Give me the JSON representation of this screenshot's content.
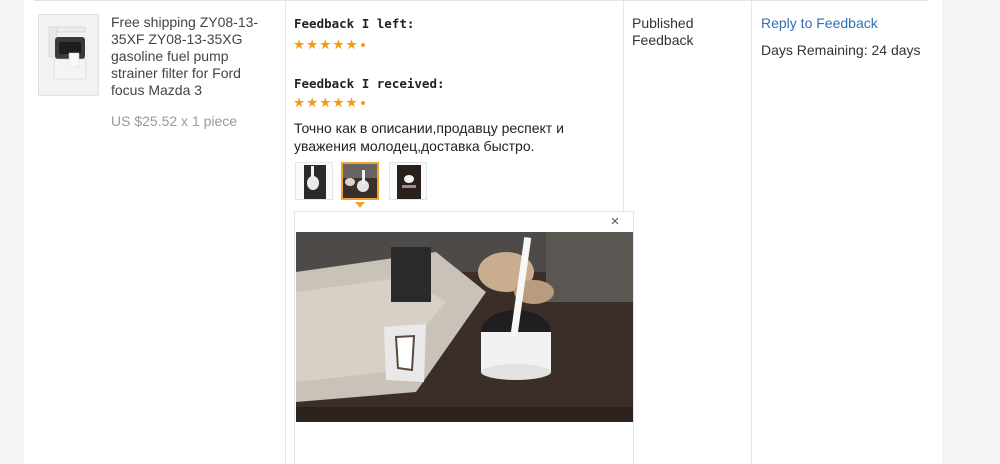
{
  "product": {
    "title": "Free shipping ZY08-13-35XF ZY08-13-35XG gasoline fuel pump strainer filter for Ford focus Mazda 3",
    "price": "US $25.52 x 1 piece"
  },
  "feedback": {
    "left_label": "Feedback I left:",
    "left_rating": 5,
    "received_label": "Feedback I received:",
    "received_rating": 5,
    "comment": "Точно как в описании,продавцу респект и уважения молодец,доставка быстро.",
    "photos": [
      {
        "icon": "photo-thumb-1"
      },
      {
        "icon": "photo-thumb-2",
        "selected": true
      },
      {
        "icon": "photo-thumb-3"
      }
    ],
    "close_symbol": "×"
  },
  "status": {
    "text": "Published Feedback"
  },
  "actions": {
    "reply_label": "Reply to Feedback",
    "days_remaining": "Days Remaining: 24 days"
  },
  "colors": {
    "star": "#f29d10",
    "link": "#2f6fb3",
    "selected_border": "#f0a234"
  }
}
